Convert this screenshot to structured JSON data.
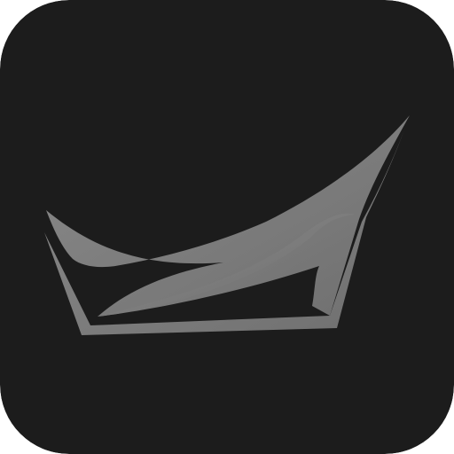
{
  "icon": {
    "name": "boat-logo-icon",
    "background_color": "#1c1c1c",
    "glyph_color": "#6f6f6f",
    "glyph_highlight_color": "#8a8a8a"
  }
}
